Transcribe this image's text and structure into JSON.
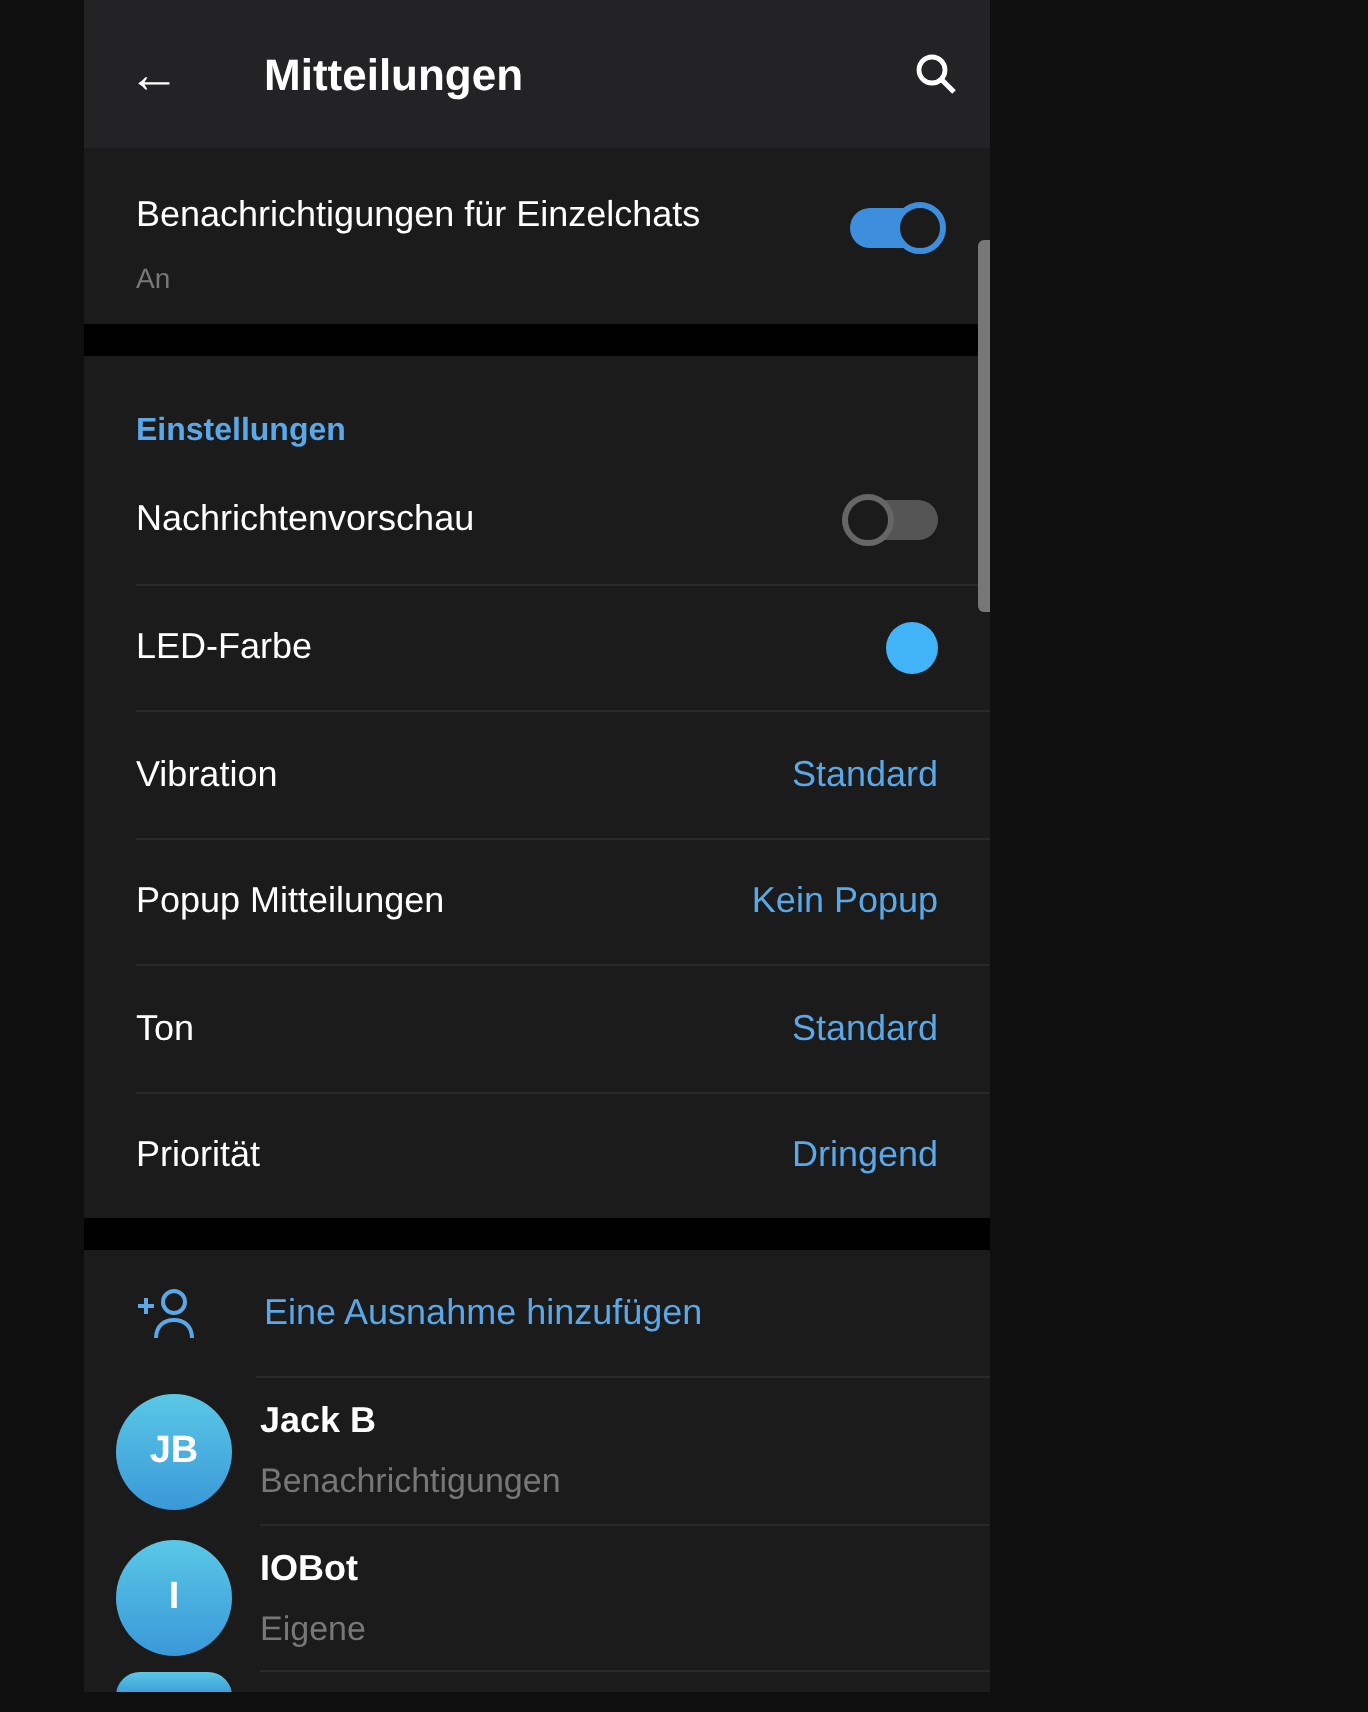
{
  "header": {
    "back_icon": "←",
    "title": "Mitteilungen"
  },
  "main_toggle": {
    "label": "Benachrichtigungen für Einzelchats",
    "subtitle": "An",
    "on": true
  },
  "settings": {
    "heading": "Einstellungen",
    "rows": [
      {
        "kind": "toggle",
        "label": "Nachrichtenvorschau",
        "on": false
      },
      {
        "kind": "color",
        "label": "LED-Farbe",
        "color": "#40b4f7"
      },
      {
        "kind": "value",
        "label": "Vibration",
        "value": "Standard"
      },
      {
        "kind": "value",
        "label": "Popup Mitteilungen",
        "value": "Kein Popup"
      },
      {
        "kind": "value",
        "label": "Ton",
        "value": "Standard"
      },
      {
        "kind": "value",
        "label": "Priorität",
        "value": "Dringend"
      }
    ]
  },
  "exceptions": {
    "add_label": "Eine Ausnahme hinzufügen",
    "items": [
      {
        "initials": "JB",
        "name": "Jack B",
        "subtitle": "Benachrichtigungen"
      },
      {
        "initials": "I",
        "name": "IOBot",
        "subtitle": "Eigene"
      }
    ]
  }
}
